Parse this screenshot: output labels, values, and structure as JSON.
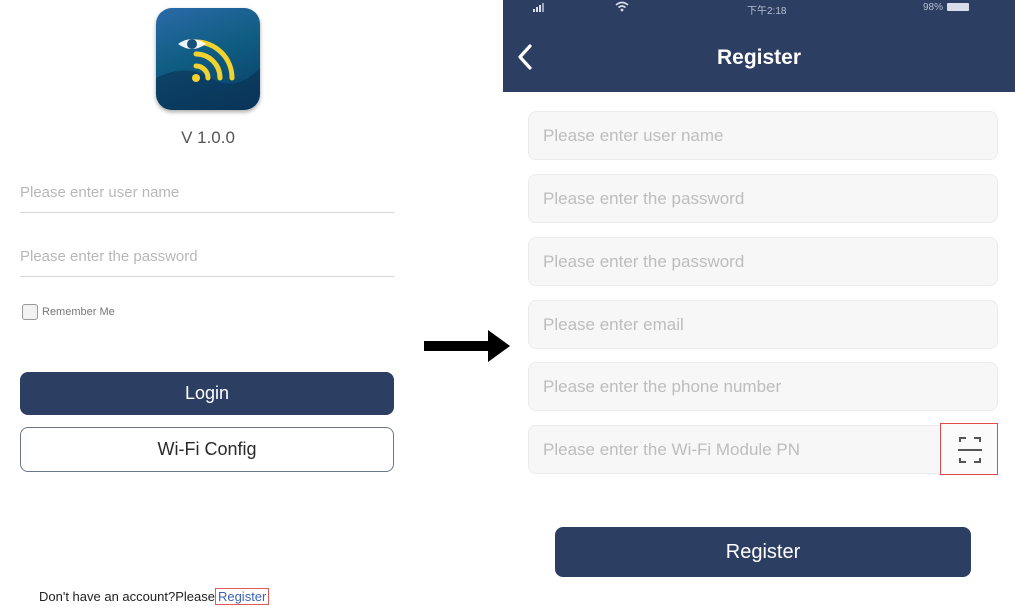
{
  "login": {
    "version": "V 1.0.0",
    "username_placeholder": "Please enter user name",
    "password_placeholder": "Please enter the password",
    "remember_label": "Remember Me",
    "login_button": "Login",
    "wifi_config_button": "Wi-Fi Config",
    "footer_text": "Don't have an account?Please",
    "register_link": "Register"
  },
  "register": {
    "status": {
      "time": "下午2:18",
      "battery": "98%"
    },
    "title": "Register",
    "fields": [
      {
        "placeholder": "Please enter user name"
      },
      {
        "placeholder": "Please enter the password"
      },
      {
        "placeholder": "Please enter the password"
      },
      {
        "placeholder": "Please enter email"
      },
      {
        "placeholder": "Please enter the phone number"
      },
      {
        "placeholder": "Please enter the Wi-Fi Module PN"
      }
    ],
    "submit_button": "Register"
  },
  "icons": {
    "app": "wifi-eye-app-icon",
    "back": "chevron-left-icon",
    "scan": "scan-icon",
    "arrow": "arrow-right-icon"
  },
  "colors": {
    "primary": "#2d3e63",
    "highlight": "#e15a5a"
  }
}
